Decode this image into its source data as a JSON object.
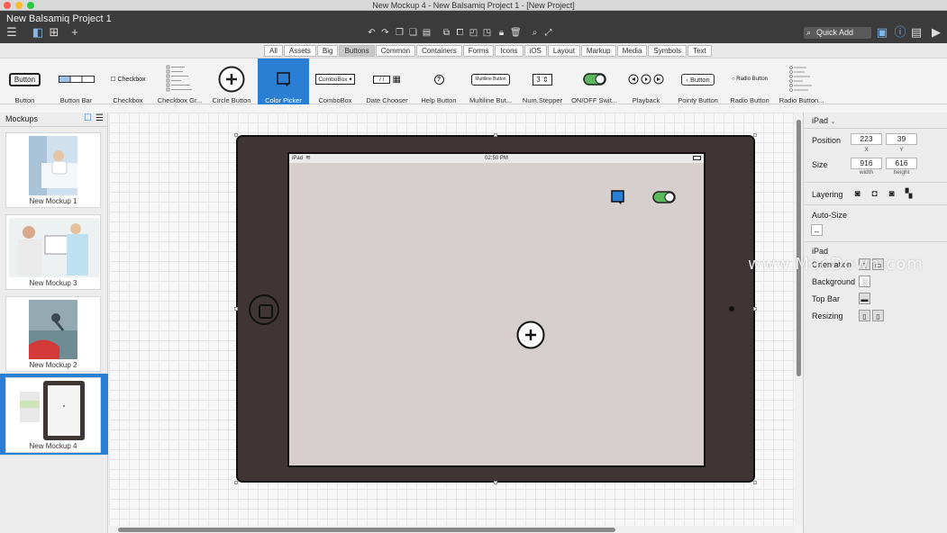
{
  "window": {
    "title": "New Mockup 4 - New Balsamiq Project 1 - [New Project]",
    "project_name": "New Balsamiq Project 1"
  },
  "colors": {
    "accent": "#2a7fd4",
    "device_body": "#3f3535",
    "screen_bg": "#d7cfcd",
    "toggle_on": "#5cb85c"
  },
  "toolbar": {
    "quick_add_placeholder": "Quick Add"
  },
  "filters": [
    "All",
    "Assets",
    "Big",
    "Buttons",
    "Common",
    "Containers",
    "Forms",
    "Icons",
    "iOS",
    "Layout",
    "Markup",
    "Media",
    "Symbols",
    "Text"
  ],
  "active_filter": "Buttons",
  "library": [
    {
      "label": "Button",
      "preview": "Button"
    },
    {
      "label": "Button Bar",
      "preview": ""
    },
    {
      "label": "Checkbox",
      "preview": "Checkbox"
    },
    {
      "label": "Checkbox Gr...",
      "preview": ""
    },
    {
      "label": "Circle Button",
      "preview": ""
    },
    {
      "label": "Color Picker",
      "preview": ""
    },
    {
      "label": "ComboBox",
      "preview": "ComboBox"
    },
    {
      "label": "Date Chooser",
      "preview": "/ /"
    },
    {
      "label": "Help Button",
      "preview": "?"
    },
    {
      "label": "Multiline But...",
      "preview": "Multiline Button"
    },
    {
      "label": "Num.Stepper",
      "preview": "3"
    },
    {
      "label": "ON/OFF Swit...",
      "preview": ""
    },
    {
      "label": "Playback",
      "preview": ""
    },
    {
      "label": "Pointy Button",
      "preview": "Button"
    },
    {
      "label": "Radio Button",
      "preview": "Radio Button"
    },
    {
      "label": "Radio Button...",
      "preview": ""
    }
  ],
  "mockups_panel": {
    "title": "Mockups",
    "items": [
      "New Mockup 1",
      "New Mockup 3",
      "New Mockup 2",
      "New Mockup 4"
    ]
  },
  "device": {
    "status_left": "iPad",
    "status_time": "02:50 PM"
  },
  "inspector": {
    "component": "iPad",
    "position_label": "Position",
    "x": "223",
    "y": "39",
    "x_label": "X",
    "y_label": "Y",
    "size_label": "Size",
    "width": "916",
    "height": "616",
    "width_label": "width",
    "height_label": "height",
    "layering_label": "Layering",
    "autosize_label": "Auto-Size",
    "section_title": "iPad",
    "orientation_label": "Orientation",
    "background_label": "Background",
    "topbar_label": "Top Bar",
    "resizing_label": "Resizing"
  },
  "watermark": "www.MacDown.com"
}
